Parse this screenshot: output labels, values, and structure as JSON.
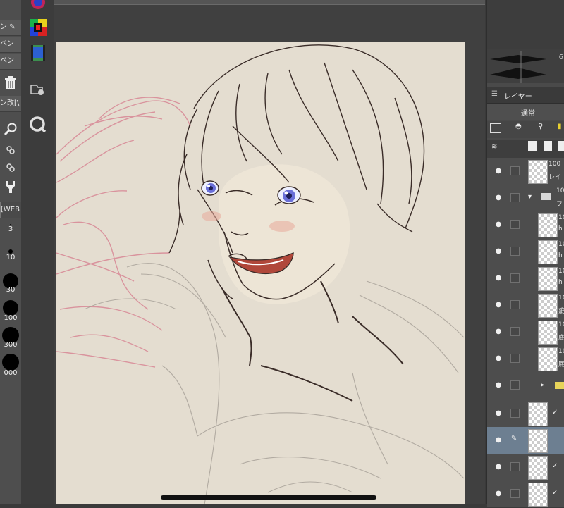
{
  "left_tools": {
    "tabs": [
      "ン ✎",
      "ペン",
      "ペン"
    ],
    "tab_pen_mod": "ン改[\\",
    "web_tab": "[WEB",
    "brush_sizes": [
      "3",
      "10",
      "30",
      "100",
      "300",
      "000"
    ]
  },
  "right_panel": {
    "zoom_partial": "6",
    "tab_label": "レイヤー",
    "blend_mode": "通常",
    "layers": [
      {
        "opacity": "100",
        "name": "レイ"
      },
      {
        "opacity": "10",
        "name": "フ"
      },
      {
        "opacity": "10",
        "name": "h"
      },
      {
        "opacity": "10",
        "name": "h"
      },
      {
        "opacity": "10",
        "name": "h"
      },
      {
        "opacity": "10",
        "name": "疵"
      },
      {
        "opacity": "10",
        "name": "底"
      },
      {
        "opacity": "10",
        "name": "底"
      }
    ]
  }
}
